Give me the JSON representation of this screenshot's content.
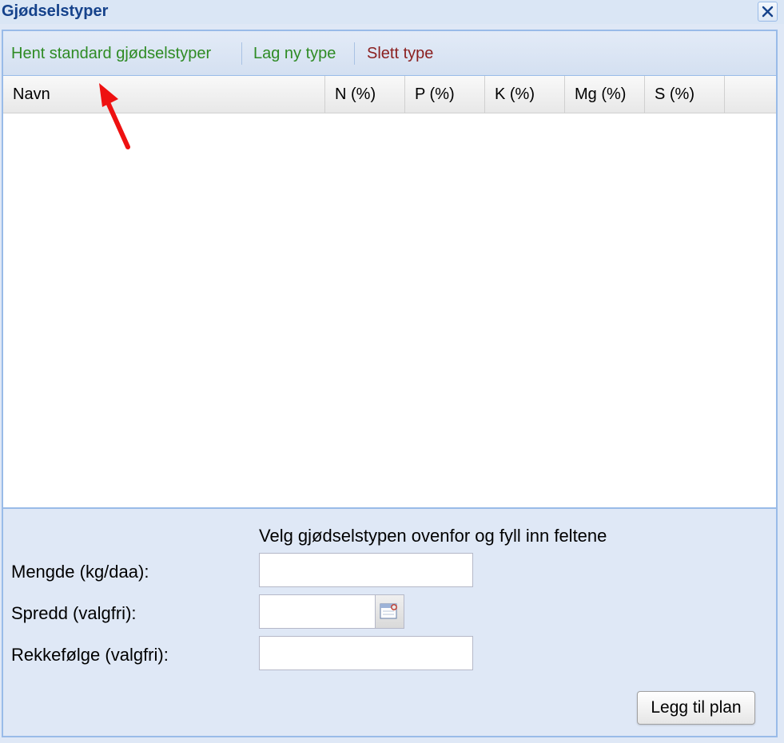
{
  "window": {
    "title": "Gjødselstyper",
    "close_icon": "close-icon"
  },
  "toolbar": {
    "load_standard": "Hent standard gjødselstyper",
    "new_type": "Lag ny type",
    "delete_type": "Slett type",
    "colors": {
      "positive": "#2e8b24",
      "danger": "#8b2020"
    }
  },
  "grid": {
    "columns": [
      "Navn",
      "N (%)",
      "P (%)",
      "K (%)",
      "Mg (%)",
      "S (%)"
    ],
    "rows": []
  },
  "form": {
    "instruction": "Velg gjødselstypen ovenfor og fyll inn feltene",
    "amount_label": "Mengde (kg/daa):",
    "amount_value": "",
    "spread_label": "Spredd (valgfri):",
    "spread_value": "",
    "order_label": "Rekkefølge (valgfri):",
    "order_value": "",
    "submit": "Legg til plan"
  },
  "annotation": {
    "icon": "red-arrow-icon",
    "color": "#ee1111"
  }
}
